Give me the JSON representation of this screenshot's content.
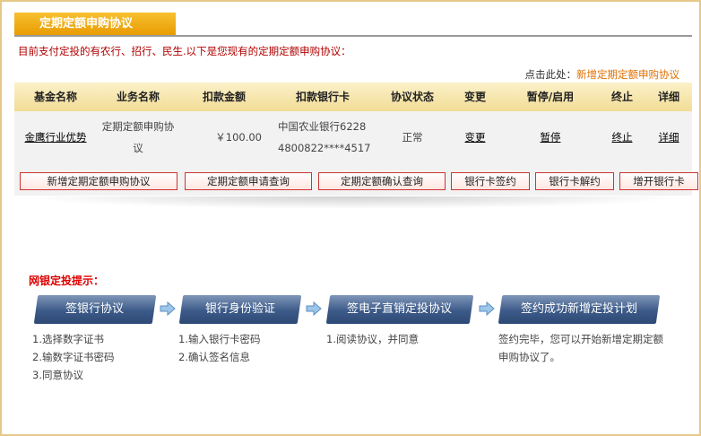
{
  "header": {
    "title": "定期定额申购协议"
  },
  "intro_text": "目前支付定投的有农行、招行、民生.以下是您现有的定期定额申购协议：",
  "add_link": {
    "prefix": "点击此处：",
    "label": "新增定期定额申购协议"
  },
  "table": {
    "headers": [
      "基金名称",
      "业务名称",
      "扣款金额",
      "扣款银行卡",
      "协议状态",
      "变更",
      "暂停/启用",
      "终止",
      "详细"
    ],
    "rows": [
      {
        "fund_name": "金鹰行业优势",
        "business_line1": "定期定额申购协",
        "business_line2": "议",
        "amount": "￥100.00",
        "bank_line1": "中国农业银行6228",
        "bank_line2": "4800822****4517",
        "status": "正常",
        "change": "变更",
        "pause": "暂停",
        "terminate": "终止",
        "detail": "详细"
      }
    ]
  },
  "buttons": {
    "add_agreement": "新增定期定额申购协议",
    "apply_query": "定期定额申请查询",
    "confirm_query": "定期定额确认查询",
    "bank_sign": "银行卡签约",
    "bank_unsign": "银行卡解约",
    "open_bank": "增开银行卡"
  },
  "tips": {
    "title": "网银定投提示：",
    "steps": [
      {
        "label": "签银行协议",
        "desc": [
          "1.选择数字证书",
          "2.输数字证书密码",
          "3.同意协议"
        ]
      },
      {
        "label": "银行身份验证",
        "desc": [
          "1.输入银行卡密码",
          "2.确认签名信息"
        ]
      },
      {
        "label": "签电子直销定投协议",
        "desc": [
          "1.阅读协议，并同意"
        ]
      },
      {
        "label": "签约成功新增定投计划",
        "desc": [
          "签约完毕，您可以开始新增定期定额",
          "申购协议了。"
        ]
      }
    ]
  },
  "colors": {
    "accent": "#e89a00",
    "intro": "#b00000",
    "link": "#e07000",
    "step": "#3c5a88"
  }
}
